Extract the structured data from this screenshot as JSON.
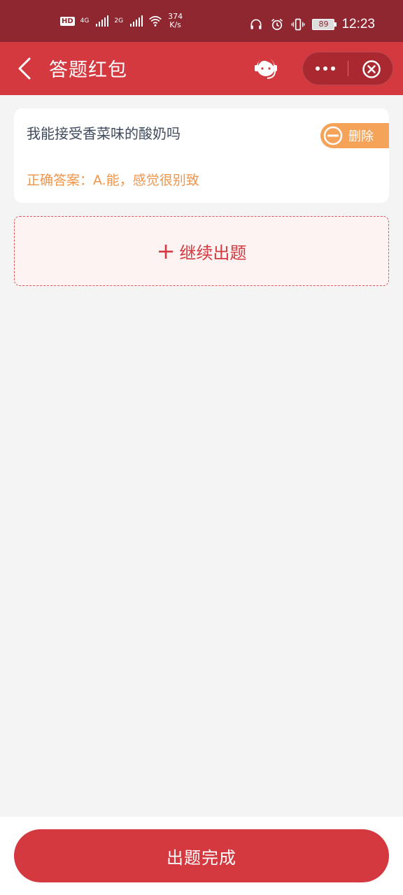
{
  "status_bar": {
    "hd": "HD",
    "net1": "4G",
    "net2": "2G",
    "speed_value": "374",
    "speed_unit": "K/s",
    "battery": "89",
    "time": "12:23"
  },
  "nav": {
    "title": "答题红包"
  },
  "question": {
    "text": "我能接受香菜味的酸奶吗",
    "answer": "正确答案：A.能，感觉很别致",
    "delete_label": "删除"
  },
  "continue_label": "继续出题",
  "finish_label": "出题完成",
  "colors": {
    "status_bar": "#8e2730",
    "nav_bar": "#d3393f",
    "delete_button": "#f6a35a",
    "answer_text": "#f0954a"
  }
}
